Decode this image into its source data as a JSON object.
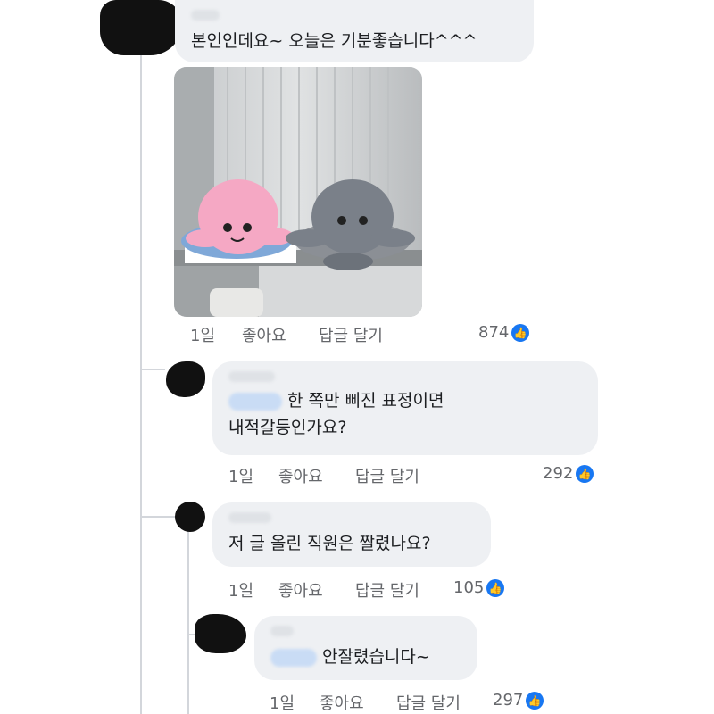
{
  "comments": [
    {
      "text": "본인인데요~ 오늘은 기분좋습니다^^^",
      "time": "1일",
      "like_label": "좋아요",
      "reply_label": "답글 달기",
      "likes": "874"
    },
    {
      "text_line1": "한 쪽만 삐진 표정이면",
      "text_line2": "내적갈등인가요?",
      "time": "1일",
      "like_label": "좋아요",
      "reply_label": "답글 달기",
      "likes": "292"
    },
    {
      "text": "저 글 올린 직원은 짤렸나요?",
      "time": "1일",
      "like_label": "좋아요",
      "reply_label": "답글 달기",
      "likes": "105"
    },
    {
      "text": "안잘렸습니다~",
      "time": "1일",
      "like_label": "좋아요",
      "reply_label": "답글 달기",
      "likes": "297"
    }
  ],
  "icons": {
    "like": "thumbs-up-icon",
    "like_color": "#1877f2"
  }
}
